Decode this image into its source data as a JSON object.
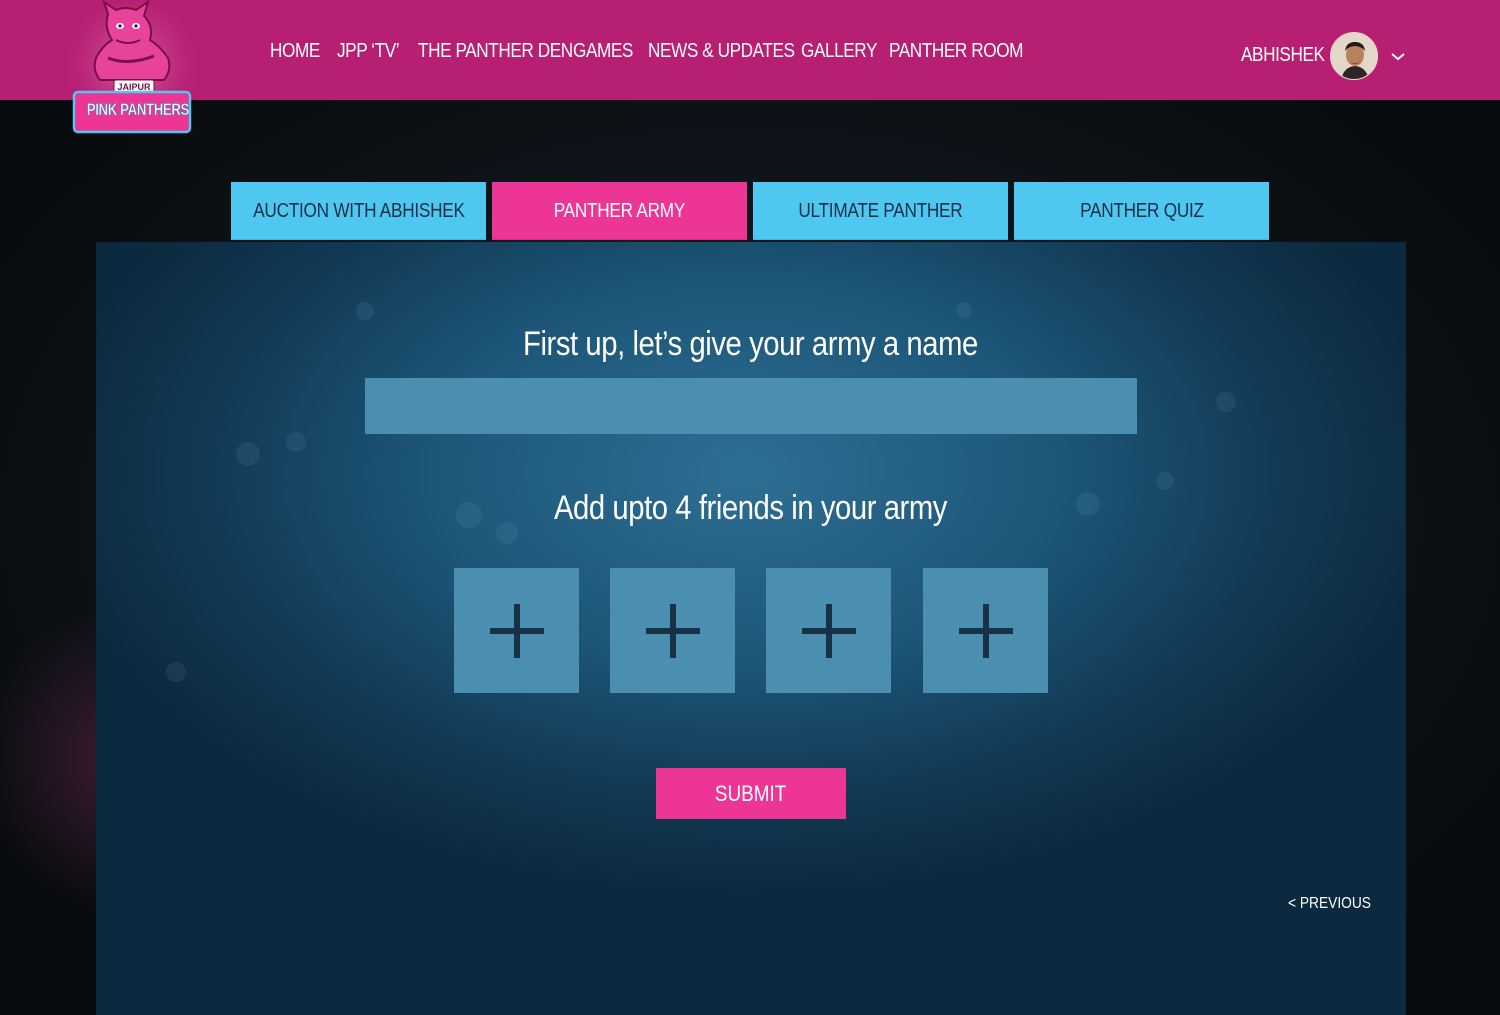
{
  "header": {
    "nav": [
      {
        "label": "HOME"
      },
      {
        "label": "JPP ‘TV’"
      },
      {
        "label": "THE PANTHER DEN"
      },
      {
        "label": "GAMES"
      },
      {
        "label": "NEWS & UPDATES"
      },
      {
        "label": "GALLERY"
      },
      {
        "label": "PANTHER ROOM"
      }
    ],
    "user_name": "ABHISHEK",
    "logo": {
      "top_text": "JAIPUR",
      "main_text": "PINK PANTHERS"
    }
  },
  "tabs": [
    {
      "label": "AUCTION WITH ABHISHEK",
      "active": false
    },
    {
      "label": "PANTHER ARMY",
      "active": true
    },
    {
      "label": "ULTIMATE PANTHER",
      "active": false
    },
    {
      "label": "PANTHER QUIZ",
      "active": false
    }
  ],
  "form": {
    "name_heading": "First up, let’s give your army a name",
    "name_value": "",
    "friends_heading": "Add upto 4 friends in your army",
    "friend_slot_count": 4,
    "submit_label": "SUBMIT",
    "previous_label": "< PREVIOUS"
  },
  "colors": {
    "header_bg": "#b71f73",
    "tab_bg": "#4ec7f1",
    "tab_active_bg": "#ec3594",
    "input_bg": "#4a8fb0",
    "submit_bg": "#ec3594"
  }
}
